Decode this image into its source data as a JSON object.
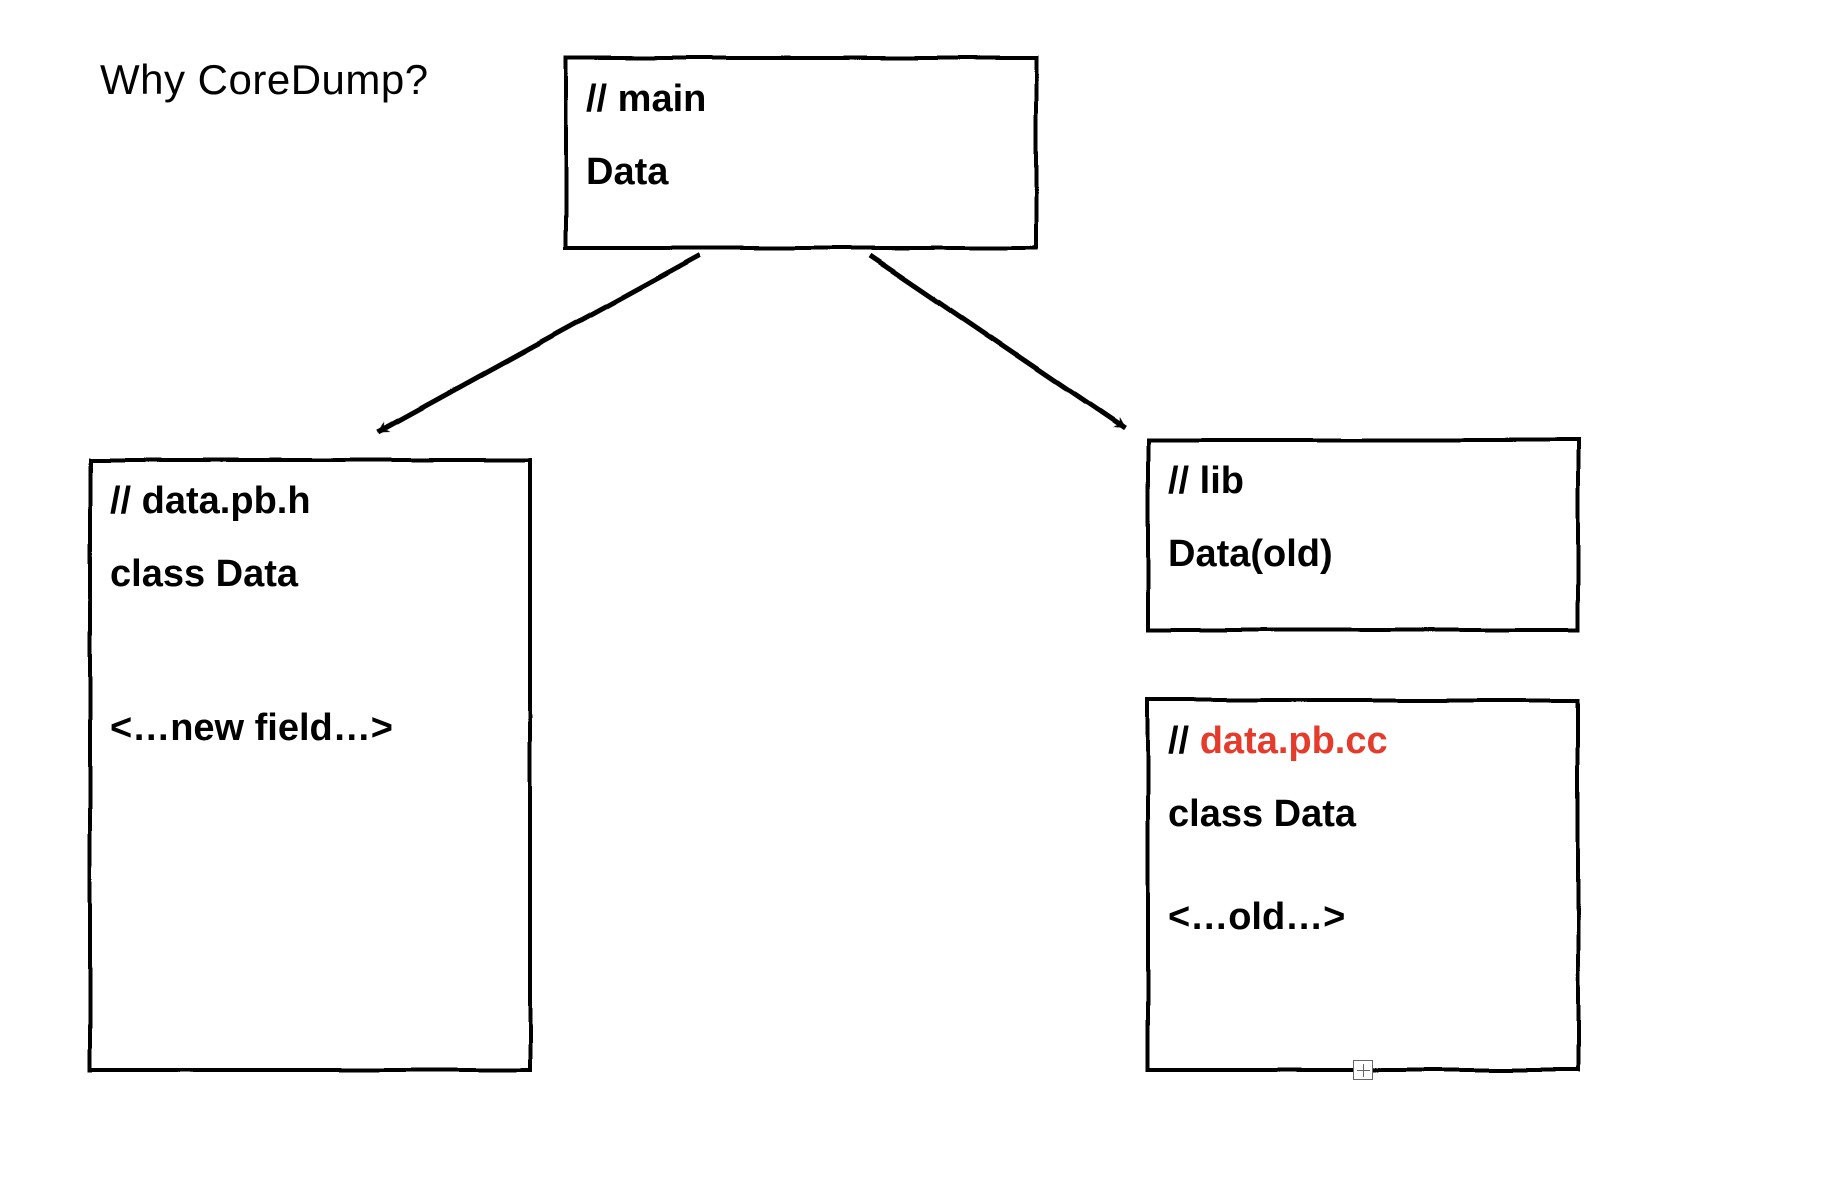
{
  "title": "Why CoreDump?",
  "nodes": {
    "main": {
      "comment": "// main",
      "body": "Data"
    },
    "data_pb_h": {
      "comment": "// data.pb.h",
      "body": "class Data\n\n\n<…new field…>"
    },
    "lib": {
      "comment": "// lib",
      "body": "Data(old)"
    },
    "data_pb_cc": {
      "comment_prefix": "// ",
      "comment_name": "data.pb.cc",
      "body": "class Data\n\n<…old…>"
    }
  },
  "colors": {
    "highlight": "#e53b2c"
  }
}
